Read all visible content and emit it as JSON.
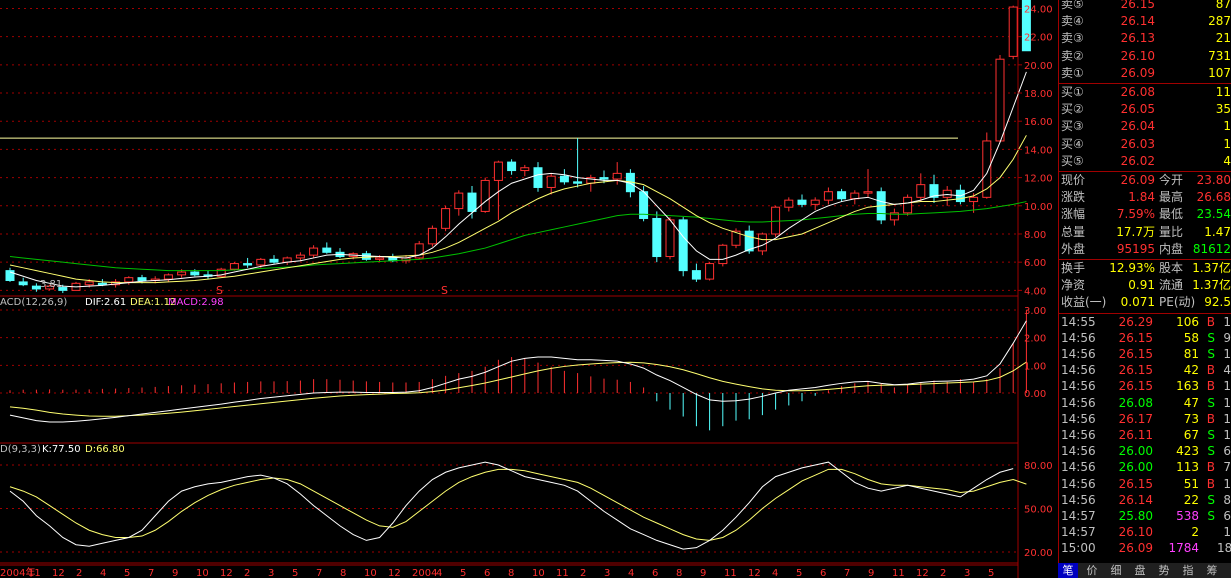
{
  "colors": {
    "up": "#ff3030",
    "down": "#54ffff",
    "ma5": "#ffffff",
    "ma10": "#ffff70",
    "ma20": "#00c000",
    "grid": "#a00000",
    "macd_pos": "#ff3030",
    "macd_neg": "#54ffff",
    "purple": "#ff40ff",
    "yellow": "#ffff00",
    "green": "#00ff00"
  },
  "price_axis": {
    "labels": [
      "24.00",
      "22.00",
      "20.00",
      "18.00",
      "16.00",
      "14.00",
      "12.00",
      "10.00",
      "8.00",
      "6.00",
      "4.00"
    ],
    "values": [
      24,
      22,
      20,
      18,
      16,
      14,
      12,
      10,
      8,
      6,
      4
    ],
    "min_low_label": "3.81",
    "hline": 14.8,
    "s_markers": [
      "S",
      "S"
    ]
  },
  "macd": {
    "title": "ACD(12,26,9)",
    "dif": "DIF:2.61",
    "dea": "DEA:1.12",
    "macd": "MACD:2.98",
    "axis": [
      "3.00",
      "2.00",
      "1.00",
      "0.00"
    ]
  },
  "kdj": {
    "title": "D(9,3,3)",
    "k": "K:77.50",
    "d": "D:66.80",
    "axis": [
      "80.00",
      "50.00",
      "20.00"
    ]
  },
  "time_axis": [
    "2004年",
    "11",
    "12",
    "2",
    "4",
    "5",
    "7",
    "9",
    "10",
    "12",
    "2",
    "3",
    "5",
    "7",
    "8",
    "10",
    "12",
    "2004",
    "4",
    "5",
    "6",
    "8",
    "10",
    "11",
    "2",
    "3",
    "4",
    "6",
    "8",
    "9",
    "11",
    "12",
    "4",
    "5",
    "6",
    "7",
    "9",
    "11",
    "12",
    "2",
    "3",
    "5"
  ],
  "chart_data": {
    "type": "candlestick",
    "ohlc": [
      [
        5.4,
        5.6,
        4.6,
        4.7
      ],
      [
        4.6,
        4.9,
        4.3,
        4.4
      ],
      [
        4.3,
        4.5,
        3.9,
        4.1
      ],
      [
        4.1,
        4.4,
        4.0,
        4.3
      ],
      [
        4.2,
        4.4,
        3.81,
        4.0
      ],
      [
        4.0,
        4.6,
        4.0,
        4.5
      ],
      [
        4.4,
        4.8,
        4.2,
        4.6
      ],
      [
        4.5,
        4.8,
        4.3,
        4.4
      ],
      [
        4.4,
        4.8,
        4.2,
        4.6
      ],
      [
        4.6,
        5.0,
        4.4,
        4.9
      ],
      [
        4.9,
        5.1,
        4.5,
        4.7
      ],
      [
        4.7,
        5.0,
        4.5,
        4.8
      ],
      [
        4.8,
        5.2,
        4.6,
        5.1
      ],
      [
        5.1,
        5.5,
        4.9,
        5.3
      ],
      [
        5.3,
        5.5,
        5.0,
        5.1
      ],
      [
        5.1,
        5.4,
        4.8,
        5.0
      ],
      [
        5.0,
        5.6,
        5.0,
        5.5
      ],
      [
        5.5,
        6.0,
        5.4,
        5.9
      ],
      [
        5.9,
        6.3,
        5.6,
        5.8
      ],
      [
        5.8,
        6.3,
        5.6,
        6.2
      ],
      [
        6.2,
        6.5,
        5.9,
        6.0
      ],
      [
        6.0,
        6.4,
        5.8,
        6.3
      ],
      [
        6.3,
        6.7,
        6.1,
        6.5
      ],
      [
        6.5,
        7.2,
        6.3,
        7.0
      ],
      [
        7.0,
        7.4,
        6.6,
        6.7
      ],
      [
        6.7,
        7.0,
        6.3,
        6.4
      ],
      [
        6.4,
        6.7,
        6.2,
        6.6
      ],
      [
        6.6,
        6.8,
        6.1,
        6.2
      ],
      [
        6.2,
        6.5,
        6.0,
        6.3
      ],
      [
        6.3,
        6.6,
        6.0,
        6.1
      ],
      [
        6.1,
        6.5,
        5.9,
        6.3
      ],
      [
        6.3,
        7.5,
        6.2,
        7.3
      ],
      [
        7.3,
        8.6,
        7.1,
        8.4
      ],
      [
        8.4,
        10.0,
        8.2,
        9.8
      ],
      [
        9.8,
        11.1,
        9.3,
        10.9
      ],
      [
        10.9,
        11.4,
        9.1,
        9.6
      ],
      [
        9.6,
        12.0,
        9.5,
        11.8
      ],
      [
        11.8,
        13.2,
        9.0,
        13.1
      ],
      [
        13.1,
        13.3,
        12.2,
        12.5
      ],
      [
        12.5,
        12.9,
        12.1,
        12.7
      ],
      [
        12.7,
        13.1,
        11.0,
        11.3
      ],
      [
        11.3,
        12.3,
        10.8,
        12.1
      ],
      [
        12.1,
        12.6,
        11.5,
        11.7
      ],
      [
        11.7,
        14.8,
        11.3,
        11.6
      ],
      [
        11.6,
        12.2,
        11.0,
        12.0
      ],
      [
        12.0,
        12.5,
        11.6,
        11.9
      ],
      [
        11.9,
        13.1,
        11.5,
        12.3
      ],
      [
        12.3,
        12.6,
        10.6,
        11.0
      ],
      [
        11.0,
        11.4,
        8.9,
        9.1
      ],
      [
        9.1,
        9.6,
        6.0,
        6.4
      ],
      [
        6.4,
        9.2,
        6.2,
        9.0
      ],
      [
        9.0,
        9.2,
        5.0,
        5.4
      ],
      [
        5.4,
        5.9,
        4.6,
        4.8
      ],
      [
        4.8,
        6.0,
        4.7,
        5.9
      ],
      [
        5.9,
        7.3,
        5.7,
        7.2
      ],
      [
        7.2,
        8.4,
        7.0,
        8.2
      ],
      [
        8.2,
        8.6,
        6.6,
        6.8
      ],
      [
        6.8,
        8.1,
        6.5,
        8.0
      ],
      [
        8.0,
        10.0,
        7.8,
        9.9
      ],
      [
        9.9,
        10.6,
        9.6,
        10.4
      ],
      [
        10.4,
        10.8,
        9.9,
        10.1
      ],
      [
        10.1,
        10.6,
        9.7,
        10.4
      ],
      [
        10.4,
        11.3,
        10.1,
        11.0
      ],
      [
        11.0,
        11.2,
        10.3,
        10.5
      ],
      [
        10.5,
        11.1,
        10.1,
        10.9
      ],
      [
        10.9,
        12.6,
        10.6,
        11.0
      ],
      [
        11.0,
        11.3,
        8.7,
        9.0
      ],
      [
        9.0,
        9.8,
        8.6,
        9.5
      ],
      [
        9.5,
        10.8,
        9.3,
        10.6
      ],
      [
        10.6,
        12.3,
        10.3,
        11.5
      ],
      [
        11.5,
        12.2,
        10.2,
        10.6
      ],
      [
        10.6,
        11.4,
        10.0,
        11.1
      ],
      [
        11.1,
        11.5,
        10.1,
        10.3
      ],
      [
        10.3,
        10.9,
        9.5,
        10.6
      ],
      [
        10.6,
        15.2,
        10.5,
        14.6
      ],
      [
        14.6,
        20.7,
        14.5,
        20.4
      ],
      [
        20.6,
        24.2,
        20.4,
        24.1
      ],
      [
        26.1,
        28.0,
        21.0,
        21.0
      ]
    ],
    "macd_hist": [
      0.1,
      0.12,
      0.12,
      0.13,
      0.12,
      0.12,
      0.13,
      0.15,
      0.16,
      0.18,
      0.2,
      0.22,
      0.25,
      0.28,
      0.3,
      0.32,
      0.35,
      0.38,
      0.4,
      0.42,
      0.42,
      0.43,
      0.45,
      0.5,
      0.5,
      0.48,
      0.45,
      0.42,
      0.4,
      0.38,
      0.38,
      0.4,
      0.5,
      0.62,
      0.72,
      0.8,
      0.95,
      1.2,
      1.3,
      1.25,
      1.1,
      0.95,
      0.8,
      0.72,
      0.6,
      0.52,
      0.48,
      0.4,
      0.2,
      -0.3,
      -0.6,
      -0.85,
      -1.2,
      -1.35,
      -1.2,
      -1.0,
      -0.95,
      -0.8,
      -0.6,
      -0.45,
      -0.3,
      -0.1,
      0.1,
      0.25,
      0.35,
      0.4,
      0.35,
      0.2,
      0.3,
      0.4,
      0.45,
      0.4,
      0.5,
      0.4,
      0.5,
      0.9,
      1.8,
      2.98
    ],
    "macd_dif": [
      -0.8,
      -0.9,
      -1.0,
      -1.05,
      -1.05,
      -1.02,
      -0.98,
      -0.93,
      -0.88,
      -0.82,
      -0.76,
      -0.7,
      -0.64,
      -0.58,
      -0.52,
      -0.46,
      -0.4,
      -0.33,
      -0.27,
      -0.2,
      -0.15,
      -0.1,
      -0.05,
      0.0,
      0.02,
      0.03,
      0.03,
      0.02,
      0.02,
      0.02,
      0.03,
      0.08,
      0.2,
      0.35,
      0.5,
      0.6,
      0.75,
      0.95,
      1.15,
      1.25,
      1.3,
      1.3,
      1.25,
      1.2,
      1.2,
      1.18,
      1.15,
      1.05,
      0.9,
      0.65,
      0.45,
      0.2,
      -0.05,
      -0.25,
      -0.3,
      -0.28,
      -0.22,
      -0.12,
      0.0,
      0.1,
      0.15,
      0.2,
      0.28,
      0.35,
      0.4,
      0.42,
      0.35,
      0.3,
      0.32,
      0.38,
      0.42,
      0.43,
      0.45,
      0.5,
      0.62,
      1.05,
      1.8,
      2.61
    ],
    "macd_dea": [
      -0.5,
      -0.55,
      -0.62,
      -0.7,
      -0.76,
      -0.8,
      -0.83,
      -0.84,
      -0.84,
      -0.82,
      -0.8,
      -0.77,
      -0.73,
      -0.69,
      -0.64,
      -0.59,
      -0.54,
      -0.49,
      -0.44,
      -0.39,
      -0.34,
      -0.29,
      -0.24,
      -0.19,
      -0.15,
      -0.11,
      -0.08,
      -0.06,
      -0.04,
      -0.02,
      -0.01,
      0.01,
      0.05,
      0.11,
      0.19,
      0.27,
      0.36,
      0.47,
      0.58,
      0.69,
      0.8,
      0.89,
      0.96,
      1.01,
      1.05,
      1.08,
      1.1,
      1.11,
      1.09,
      1.03,
      0.95,
      0.84,
      0.7,
      0.55,
      0.42,
      0.32,
      0.23,
      0.15,
      0.1,
      0.08,
      0.08,
      0.1,
      0.13,
      0.17,
      0.22,
      0.26,
      0.28,
      0.29,
      0.3,
      0.32,
      0.34,
      0.36,
      0.38,
      0.4,
      0.45,
      0.57,
      0.8,
      1.12
    ],
    "kdj_k": [
      62,
      55,
      45,
      38,
      30,
      25,
      24,
      26,
      28,
      30,
      35,
      45,
      55,
      62,
      65,
      67,
      68,
      70,
      72,
      73,
      71,
      67,
      60,
      52,
      45,
      38,
      32,
      28,
      30,
      40,
      52,
      62,
      70,
      75,
      78,
      80,
      82,
      80,
      76,
      72,
      70,
      68,
      66,
      62,
      55,
      48,
      42,
      36,
      32,
      28,
      25,
      22,
      23,
      28,
      35,
      44,
      54,
      65,
      72,
      75,
      78,
      80,
      82,
      75,
      68,
      64,
      62,
      64,
      66,
      64,
      62,
      60,
      58,
      64,
      70,
      75,
      77.5
    ],
    "kdj_d": [
      65,
      62,
      58,
      52,
      46,
      40,
      35,
      32,
      30,
      30,
      31,
      35,
      41,
      48,
      54,
      59,
      63,
      66,
      68,
      70,
      71,
      70,
      67,
      62,
      57,
      52,
      47,
      42,
      38,
      37,
      41,
      48,
      55,
      62,
      68,
      72,
      75,
      77,
      77,
      76,
      74,
      72,
      70,
      68,
      64,
      59,
      54,
      49,
      44,
      40,
      36,
      32,
      29,
      28,
      30,
      35,
      42,
      50,
      57,
      63,
      69,
      73,
      77,
      77,
      74,
      70,
      67,
      66,
      66,
      65,
      64,
      63,
      61,
      62,
      65,
      68,
      70,
      66.8
    ],
    "ma5": [
      5.3,
      5.0,
      4.7,
      4.5,
      4.3,
      4.25,
      4.3,
      4.35,
      4.45,
      4.55,
      4.65,
      4.7,
      4.75,
      4.85,
      4.95,
      5.0,
      5.1,
      5.3,
      5.5,
      5.7,
      5.85,
      6.0,
      6.1,
      6.3,
      6.5,
      6.55,
      6.5,
      6.45,
      6.4,
      6.35,
      6.3,
      6.5,
      7.0,
      7.8,
      8.7,
      9.5,
      10.3,
      11.0,
      11.6,
      11.9,
      12.2,
      12.3,
      12.2,
      12.0,
      11.9,
      11.8,
      11.8,
      11.6,
      11.0,
      10.0,
      9.0,
      7.8,
      6.8,
      6.2,
      6.2,
      6.5,
      6.9,
      7.2,
      7.7,
      8.4,
      9.0,
      9.6,
      10.0,
      10.3,
      10.5,
      10.6,
      10.3,
      10.1,
      10.2,
      10.4,
      10.7,
      10.8,
      10.7,
      11.1,
      12.3,
      14.5,
      17.0,
      19.5
    ],
    "ma10": [
      5.8,
      5.6,
      5.4,
      5.2,
      5.0,
      4.8,
      4.7,
      4.6,
      4.55,
      4.55,
      4.55,
      4.55,
      4.6,
      4.65,
      4.7,
      4.8,
      4.9,
      5.0,
      5.15,
      5.3,
      5.45,
      5.6,
      5.75,
      5.9,
      6.05,
      6.2,
      6.3,
      6.35,
      6.4,
      6.4,
      6.45,
      6.5,
      6.7,
      7.0,
      7.4,
      7.9,
      8.4,
      8.9,
      9.5,
      10.0,
      10.5,
      10.9,
      11.2,
      11.4,
      11.6,
      11.7,
      11.8,
      11.7,
      11.5,
      11.0,
      10.5,
      9.9,
      9.3,
      8.8,
      8.4,
      8.1,
      7.8,
      7.6,
      7.6,
      7.8,
      8.0,
      8.4,
      8.8,
      9.2,
      9.6,
      9.9,
      10.0,
      10.1,
      10.2,
      10.3,
      10.3,
      10.4,
      10.5,
      10.7,
      11.2,
      12.0,
      13.3,
      15.0
    ],
    "ma20": [
      6.4,
      6.3,
      6.2,
      6.1,
      6.0,
      5.9,
      5.8,
      5.7,
      5.6,
      5.55,
      5.5,
      5.45,
      5.4,
      5.4,
      5.4,
      5.4,
      5.4,
      5.45,
      5.5,
      5.55,
      5.6,
      5.65,
      5.7,
      5.8,
      5.85,
      5.9,
      5.95,
      6.0,
      6.05,
      6.1,
      6.15,
      6.2,
      6.3,
      6.45,
      6.6,
      6.8,
      7.0,
      7.3,
      7.6,
      7.9,
      8.1,
      8.3,
      8.5,
      8.7,
      8.9,
      9.1,
      9.3,
      9.4,
      9.4,
      9.35,
      9.3,
      9.25,
      9.2,
      9.1,
      9.0,
      8.9,
      8.85,
      8.85,
      8.9,
      8.95,
      9.0,
      9.1,
      9.2,
      9.3,
      9.4,
      9.45,
      9.45,
      9.4,
      9.4,
      9.45,
      9.5,
      9.55,
      9.6,
      9.7,
      9.8,
      9.95,
      10.1,
      10.3
    ],
    "ylim": [
      3.6,
      24.6
    ]
  },
  "quote": {
    "sell": [
      {
        "label": "卖⑤",
        "price": "26.15",
        "vol": "87"
      },
      {
        "label": "卖④",
        "price": "26.14",
        "vol": "287"
      },
      {
        "label": "卖③",
        "price": "26.13",
        "vol": "21"
      },
      {
        "label": "卖②",
        "price": "26.10",
        "vol": "731"
      },
      {
        "label": "卖①",
        "price": "26.09",
        "vol": "107"
      }
    ],
    "buy": [
      {
        "label": "买①",
        "price": "26.08",
        "vol": "11"
      },
      {
        "label": "买②",
        "price": "26.05",
        "vol": "35"
      },
      {
        "label": "买③",
        "price": "26.04",
        "vol": "1"
      },
      {
        "label": "买④",
        "price": "26.03",
        "vol": "1"
      },
      {
        "label": "买⑤",
        "price": "26.02",
        "vol": "4"
      }
    ],
    "stats": [
      {
        "l1": "现价",
        "v1": "26.09",
        "l2": "今开",
        "v2": "23.80"
      },
      {
        "l1": "涨跌",
        "v1": "1.84",
        "l2": "最高",
        "v2": "26.68"
      },
      {
        "l1": "涨幅",
        "v1": "7.59%",
        "l2": "最低",
        "v2": "23.54"
      },
      {
        "l1": "总量",
        "v1": "17.7万",
        "l2": "量比",
        "v2": "1.47"
      },
      {
        "l1": "外盘",
        "v1": "95195",
        "l2": "内盘",
        "v2": "81612"
      },
      {
        "l1": "换手",
        "v1": "12.93%",
        "l2": "股本",
        "v2": "1.37亿"
      },
      {
        "l1": "净资",
        "v1": "0.91",
        "l2": "流通",
        "v2": "1.37亿"
      },
      {
        "l1": "收益(一)",
        "v1": "0.071",
        "l2": "PE(动)",
        "v2": "92.5"
      }
    ],
    "ticks": [
      {
        "t": "14:55",
        "p": "26.29",
        "v": "106",
        "s": "B",
        "x": "1"
      },
      {
        "t": "14:56",
        "p": "26.15",
        "v": "58",
        "s": "S",
        "x": "9"
      },
      {
        "t": "14:56",
        "p": "26.15",
        "v": "81",
        "s": "S",
        "x": "1"
      },
      {
        "t": "14:56",
        "p": "26.15",
        "v": "42",
        "s": "B",
        "x": "4"
      },
      {
        "t": "14:56",
        "p": "26.15",
        "v": "163",
        "s": "B",
        "x": "1"
      },
      {
        "t": "14:56",
        "p": "26.08",
        "v": "47",
        "s": "S",
        "x": "1"
      },
      {
        "t": "14:56",
        "p": "26.17",
        "v": "73",
        "s": "B",
        "x": "1"
      },
      {
        "t": "14:56",
        "p": "26.11",
        "v": "67",
        "s": "S",
        "x": "1"
      },
      {
        "t": "14:56",
        "p": "26.00",
        "v": "423",
        "s": "S",
        "x": "6"
      },
      {
        "t": "14:56",
        "p": "26.00",
        "v": "113",
        "s": "B",
        "x": "7"
      },
      {
        "t": "14:56",
        "p": "26.15",
        "v": "51",
        "s": "B",
        "x": "1"
      },
      {
        "t": "14:56",
        "p": "26.14",
        "v": "22",
        "s": "S",
        "x": "8"
      },
      {
        "t": "14:57",
        "p": "25.80",
        "v": "538",
        "s": "S",
        "x": "6"
      },
      {
        "t": "14:57",
        "p": "26.10",
        "v": "2",
        "s": "",
        "x": "1"
      },
      {
        "t": "15:00",
        "p": "26.09",
        "v": "1784",
        "s": "",
        "x": "18"
      }
    ]
  },
  "tabs": [
    "笔",
    "价",
    "细",
    "盘",
    "势",
    "指",
    "筹"
  ]
}
